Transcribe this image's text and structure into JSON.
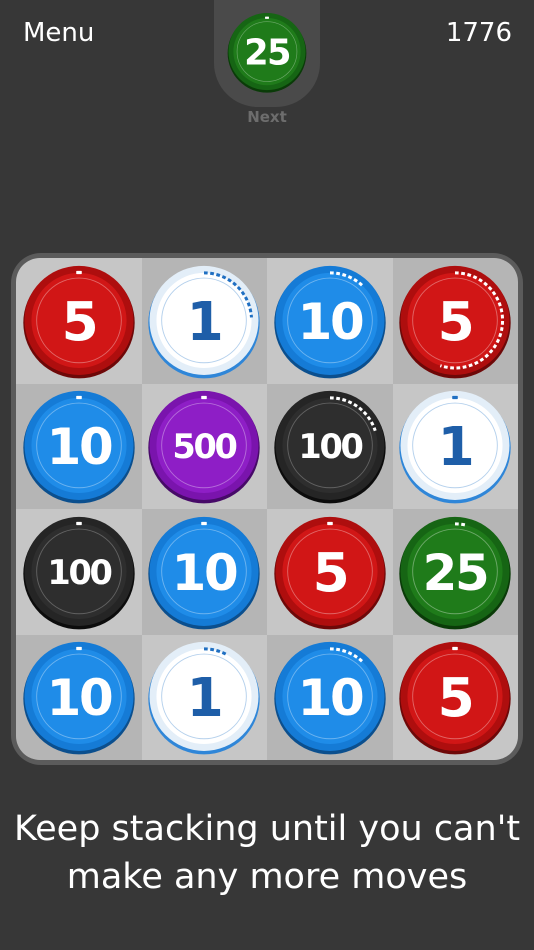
{
  "header": {
    "menu_label": "Menu",
    "score": "1776"
  },
  "next": {
    "label": "Next",
    "chip": {
      "value": "25",
      "color": "green",
      "progress": 0
    }
  },
  "palette": {
    "red": {
      "face": "#d11616",
      "rim": "#ae0e0e",
      "edge": "#6e0808",
      "text": "#ffffff",
      "mark": "#ffffff",
      "ring": "rgba(255,255,255,0.35)"
    },
    "white": {
      "face": "#ffffff",
      "rim": "#e3eef8",
      "edge": "#2f86d8",
      "text": "#1e5ea8",
      "mark": "#1f6fc2",
      "ring": "rgba(40,120,200,0.35)"
    },
    "blue": {
      "face": "#1f8ce8",
      "rim": "#157bd6",
      "edge": "#0b4f8e",
      "text": "#ffffff",
      "mark": "#ffffff",
      "ring": "rgba(255,255,255,0.35)"
    },
    "purple": {
      "face": "#8e1ec6",
      "rim": "#7a14ad",
      "edge": "#470a68",
      "text": "#ffffff",
      "mark": "#ffffff",
      "ring": "rgba(255,255,255,0.35)"
    },
    "black": {
      "face": "#2e2e2e",
      "rim": "#252525",
      "edge": "#0c0c0c",
      "text": "#ffffff",
      "mark": "#ffffff",
      "ring": "rgba(255,255,255,0.25)"
    },
    "green": {
      "face": "#1f7b1a",
      "rim": "#166514",
      "edge": "#0a3b08",
      "text": "#ffffff",
      "mark": "#ffffff",
      "ring": "rgba(255,255,255,0.35)"
    }
  },
  "board": {
    "rows": [
      [
        {
          "value": "5",
          "color": "red",
          "progress": 0
        },
        {
          "value": "1",
          "color": "white",
          "progress": 0.24
        },
        {
          "value": "10",
          "color": "blue",
          "progress": 0.12
        },
        {
          "value": "5",
          "color": "red",
          "progress": 0.55
        }
      ],
      [
        {
          "value": "10",
          "color": "blue",
          "progress": 0
        },
        {
          "value": "500",
          "color": "purple",
          "progress": 0
        },
        {
          "value": "100",
          "color": "black",
          "progress": 0.2
        },
        {
          "value": "1",
          "color": "white",
          "progress": 0
        }
      ],
      [
        {
          "value": "100",
          "color": "black",
          "progress": 0
        },
        {
          "value": "10",
          "color": "blue",
          "progress": 0
        },
        {
          "value": "5",
          "color": "red",
          "progress": 0
        },
        {
          "value": "25",
          "color": "green",
          "progress": 0.04
        }
      ],
      [
        {
          "value": "10",
          "color": "blue",
          "progress": 0
        },
        {
          "value": "1",
          "color": "white",
          "progress": 0.08
        },
        {
          "value": "10",
          "color": "blue",
          "progress": 0.12
        },
        {
          "value": "5",
          "color": "red",
          "progress": 0
        }
      ]
    ]
  },
  "hint": {
    "line1": "Keep stacking until you can't",
    "line2": "make any more moves"
  }
}
